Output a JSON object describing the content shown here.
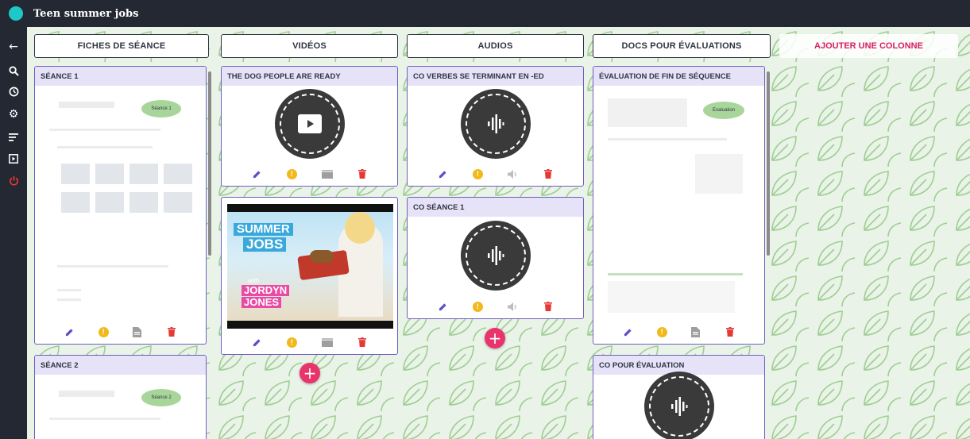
{
  "app": {
    "title": "Teen summer jobs"
  },
  "sidebar": {
    "icons": [
      {
        "name": "back-arrow-icon",
        "glyph": "←"
      },
      {
        "name": "search-icon",
        "glyph": "🔍"
      },
      {
        "name": "clock-icon",
        "glyph": "◷"
      },
      {
        "name": "gear-icon",
        "glyph": "⚙"
      },
      {
        "name": "list-icon",
        "glyph": "≡"
      },
      {
        "name": "present-icon",
        "glyph": "▣"
      },
      {
        "name": "power-icon",
        "glyph": "⏻"
      }
    ]
  },
  "columns": [
    {
      "label": "FICHES DE SÉANCE"
    },
    {
      "label": "VIDÉOS"
    },
    {
      "label": "AUDIOS"
    },
    {
      "label": "DOCS POUR ÉVALUATIONS"
    }
  ],
  "add_column": {
    "label": "AJOUTER UNE COLONNE"
  },
  "cards": {
    "seance1": {
      "title": "SÉANCE 1",
      "pill": "Séance 1"
    },
    "seance2": {
      "title": "SÉANCE 2",
      "pill": "Séance 2"
    },
    "dog_people": {
      "title": "THE DOG PEOPLE ARE READY"
    },
    "summer_video": {
      "thumb_line1": "SUMMER",
      "thumb_line2": "JOBS",
      "thumb_with": "with",
      "thumb_name1": "JORDYN",
      "thumb_name2": "JONES"
    },
    "co_verbes": {
      "title": "CO VERBES SE TERMINANT EN -ED"
    },
    "co_seance1": {
      "title": "CO SÉANCE 1"
    },
    "eval_fin": {
      "title": "ÉVALUATION DE FIN DE SÉQUENCE",
      "pill": "Evaluation"
    },
    "co_eval": {
      "title": "CO POUR ÉVALUATION"
    }
  },
  "colors": {
    "accent": "#6f5fc0",
    "fab": "#e8336c",
    "delete": "#e53935",
    "info": "#f2b91c",
    "edit": "#5b4fc8",
    "sidebar": "#232833"
  }
}
